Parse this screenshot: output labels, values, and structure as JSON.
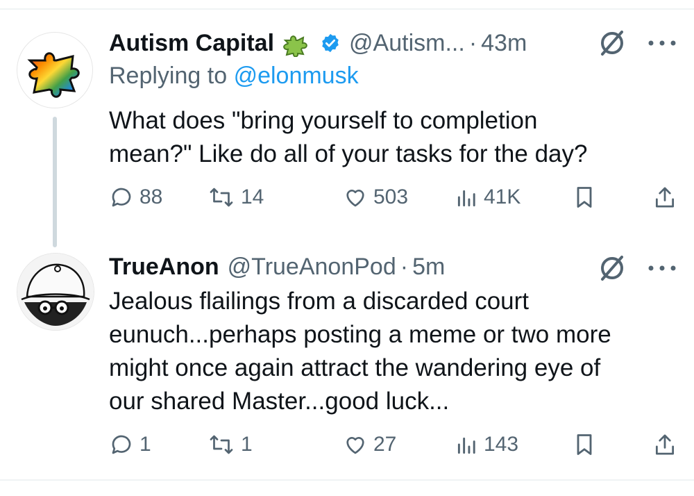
{
  "tweets": [
    {
      "display_name": "Autism Capital",
      "badge_icon": "puzzle-piece-icon",
      "verified": true,
      "handle": "@Autism...",
      "separator": "·",
      "time": "43m",
      "replying_prefix": "Replying to",
      "replying_handle": "@elonmusk",
      "text_lines": [
        "What does \"bring yourself to completion",
        "mean?\" Like do all of your tasks for the day?"
      ],
      "stats": {
        "replies": "88",
        "reposts": "14",
        "likes": "503",
        "views": "41K"
      }
    },
    {
      "display_name": "TrueAnon",
      "handle": "@TrueAnonPod",
      "separator": "·",
      "time": "5m",
      "text_lines": [
        "Jealous flailings from a discarded court",
        "eunuch...perhaps posting a meme or two more",
        "might once again attract the wandering eye of",
        "our shared Master...good luck..."
      ],
      "stats": {
        "replies": "1",
        "reposts": "1",
        "likes": "27",
        "views": "143"
      }
    }
  ],
  "colors": {
    "text": "#0f1419",
    "secondary": "#536471",
    "link": "#1d9bf0",
    "verified": "#1d9bf0"
  }
}
